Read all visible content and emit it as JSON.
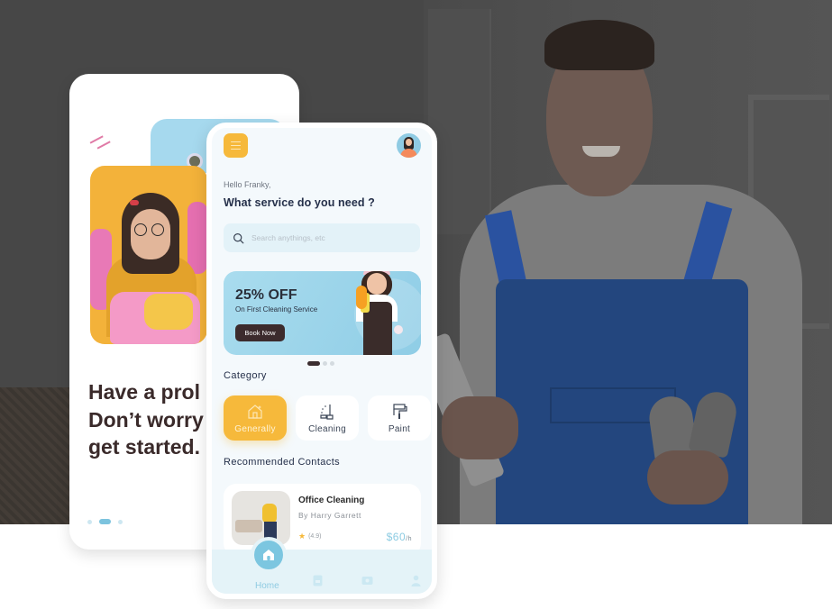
{
  "onboarding": {
    "heading": "Have a prol\nDon’t worry\nget started.",
    "pagination": {
      "total": 3,
      "active": 2
    }
  },
  "app": {
    "menu_icon": "hamburger-menu-icon",
    "avatar_icon": "user-avatar",
    "greeting": "Hello Franky,",
    "question": "What service do you need ?",
    "search": {
      "placeholder": "Search anythings, etc",
      "value": "",
      "icon": "search-icon"
    },
    "promo": {
      "title": "25% OFF",
      "subtitle": "On First Cleaning Service",
      "button_label": "Book Now",
      "pagination": {
        "total": 3,
        "active": 1
      }
    },
    "category": {
      "title": "Category",
      "items": [
        {
          "label": "Generally",
          "icon": "house-sparkle-icon",
          "active": true
        },
        {
          "label": "Cleaning",
          "icon": "mop-bucket-icon",
          "active": false
        },
        {
          "label": "Paint",
          "icon": "paint-roller-icon",
          "active": false
        }
      ]
    },
    "recommended": {
      "title": "Recommended Contacts",
      "items": [
        {
          "title": "Office Cleaning",
          "by": "By Harry Garrett",
          "rating": "(4.9)",
          "price": "$60",
          "unit": "/h"
        }
      ]
    },
    "bottom_nav": {
      "items": [
        {
          "label": "Home",
          "icon": "home-icon",
          "active": true
        },
        {
          "label": "",
          "icon": "document-icon",
          "active": false
        },
        {
          "label": "",
          "icon": "ticket-icon",
          "active": false
        },
        {
          "label": "",
          "icon": "profile-icon",
          "active": false
        }
      ]
    },
    "colors": {
      "accent_yellow": "#f6b93b",
      "accent_blue": "#7cc6e0",
      "dark_button": "#3c2b2d",
      "text_dark": "#25304a"
    }
  }
}
